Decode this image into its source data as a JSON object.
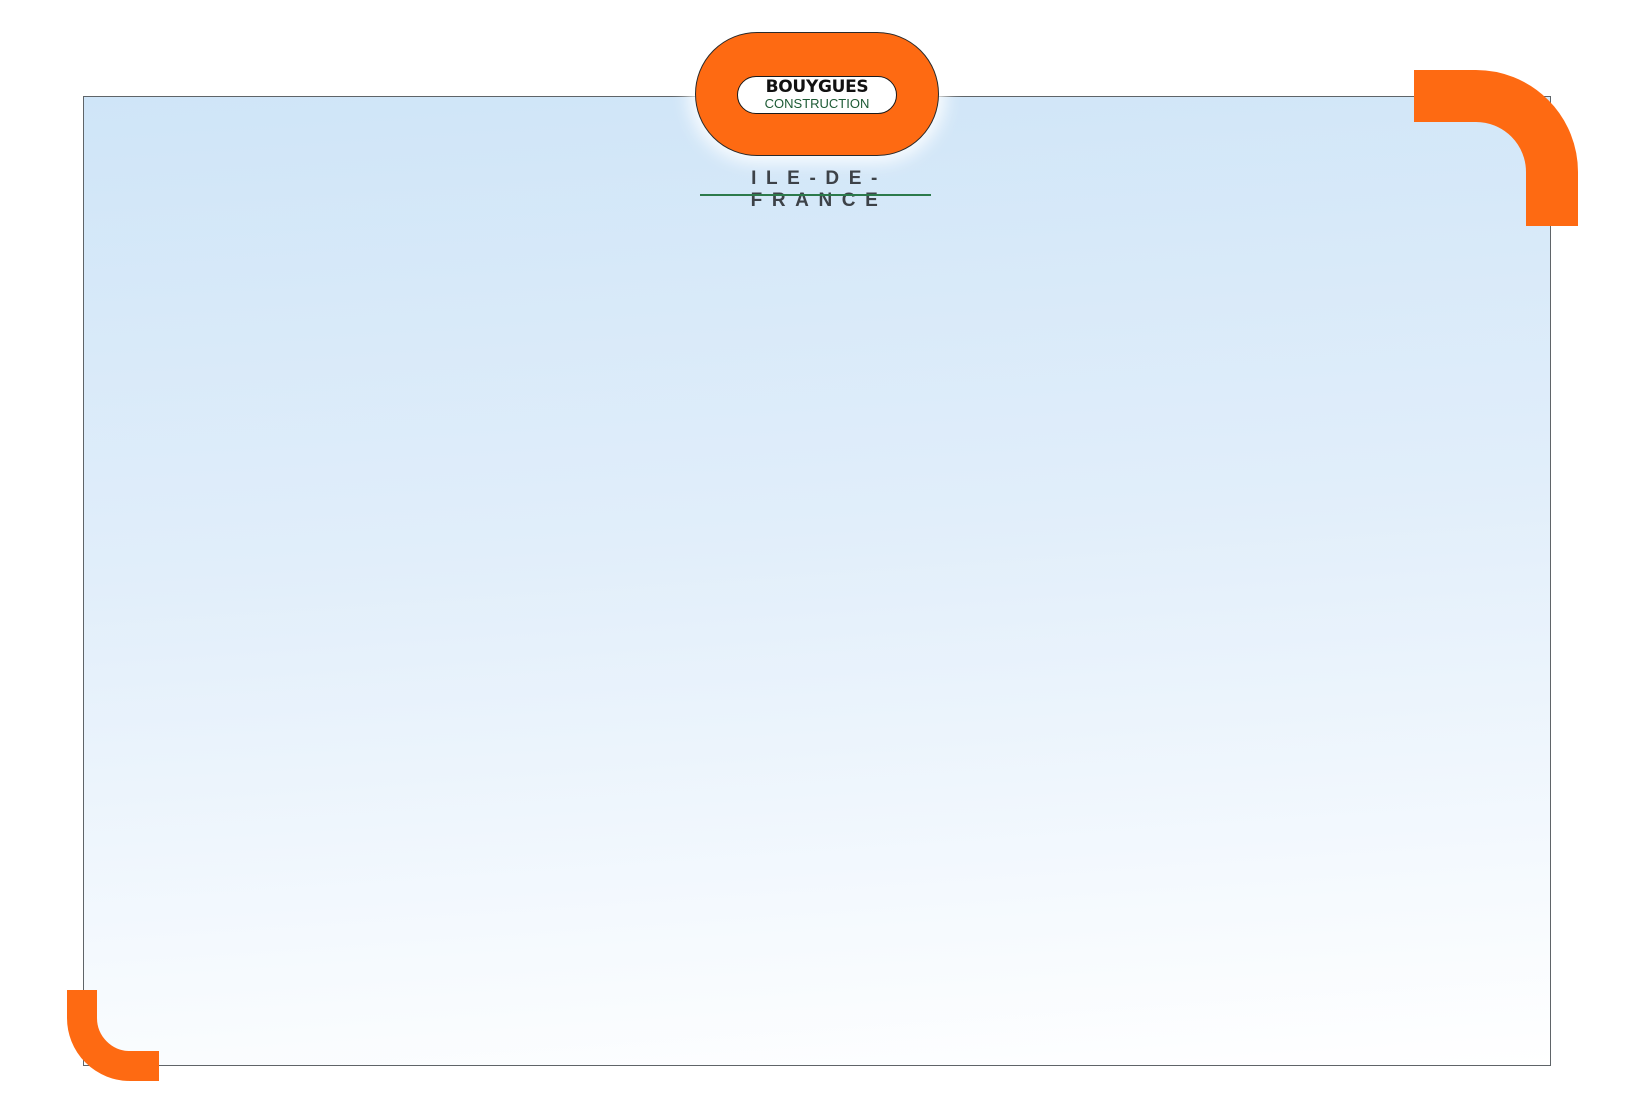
{
  "logo": {
    "line1": "BOUYGUES",
    "line2": "CONSTRUCTION",
    "region": "ILE-DE-FRANCE"
  },
  "colors": {
    "accent": "#fe6a12",
    "frame": "#5f6468",
    "region_text": "#3d4248",
    "region_rule": "#2c7a4b",
    "gradient_top": "#cfe5f8",
    "gradient_bottom": "#ffffff"
  },
  "decorations": [
    "corner-bracket-top-right",
    "corner-bracket-bottom-left"
  ]
}
